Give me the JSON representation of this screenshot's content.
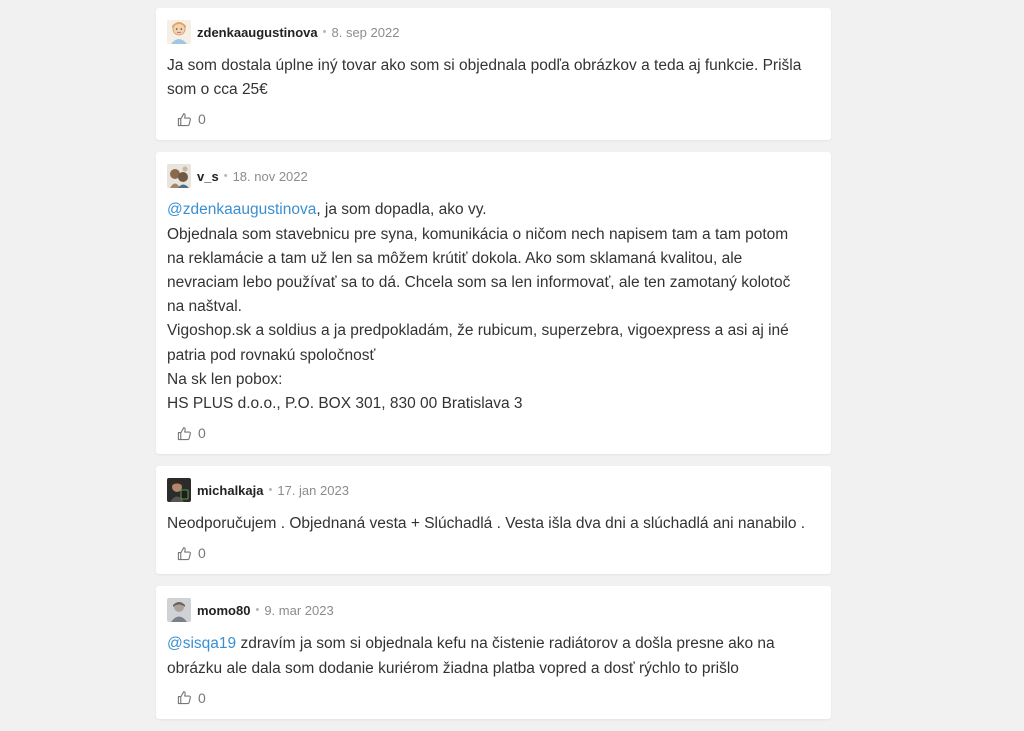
{
  "comments": [
    {
      "user": "zdenkaaugustinova",
      "date": "8. sep 2022",
      "lines": [
        "Ja som dostala úplne iný tovar ako som si objednala podľa obrázkov a teda aj funkcie. Prišla",
        "som o cca 25€"
      ],
      "likes": "0"
    },
    {
      "user": "v_s",
      "date": "18. nov 2022",
      "mention": "@zdenkaaugustinova",
      "mention_rest": ", ja som dopadla, ako vy.",
      "lines": [
        "Objednala som stavebnicu pre syna, komunikácia o ničom nech napisem tam a tam potom",
        "na reklamácie a tam už len sa môžem krútiť dokola. Ako som sklamaná kvalitou, ale",
        "nevraciam lebo používať sa to dá. Chcela som sa len informovať, ale ten zamotaný kolotoč",
        "na naštval.",
        "Vigoshop.sk a soldius a ja predpokladám, že rubicum, superzebra, vigoexpress a asi aj iné",
        "patria pod rovnakú spoločnosť",
        "Na sk len pobox:",
        "HS PLUS d.o.o., P.O. BOX 301, 830 00 Bratislava 3"
      ],
      "likes": "0"
    },
    {
      "user": "michalkaja",
      "date": "17. jan 2023",
      "lines": [
        "Neodporučujem . Objednaná vesta + Slúchadlá . Vesta išla dva dni a slúchadlá ani nanabilo ."
      ],
      "likes": "0"
    },
    {
      "user": "momo80",
      "date": "9. mar 2023",
      "mention": "@sisqa19",
      "mention_rest": " zdravím ja som si objednala kefu na čistenie radiátorov a došla presne ako na",
      "lines": [
        "obrázku ale dala som dodanie kuriérom žiadna platba vopred a dosť rýchlo to prišlo"
      ],
      "likes": "0"
    }
  ],
  "separator": "•",
  "colors": {
    "mention": "#3a8fd1",
    "background": "#f1f1f1",
    "card": "#ffffff"
  },
  "icons": {
    "like": "thumbs-up-icon"
  }
}
